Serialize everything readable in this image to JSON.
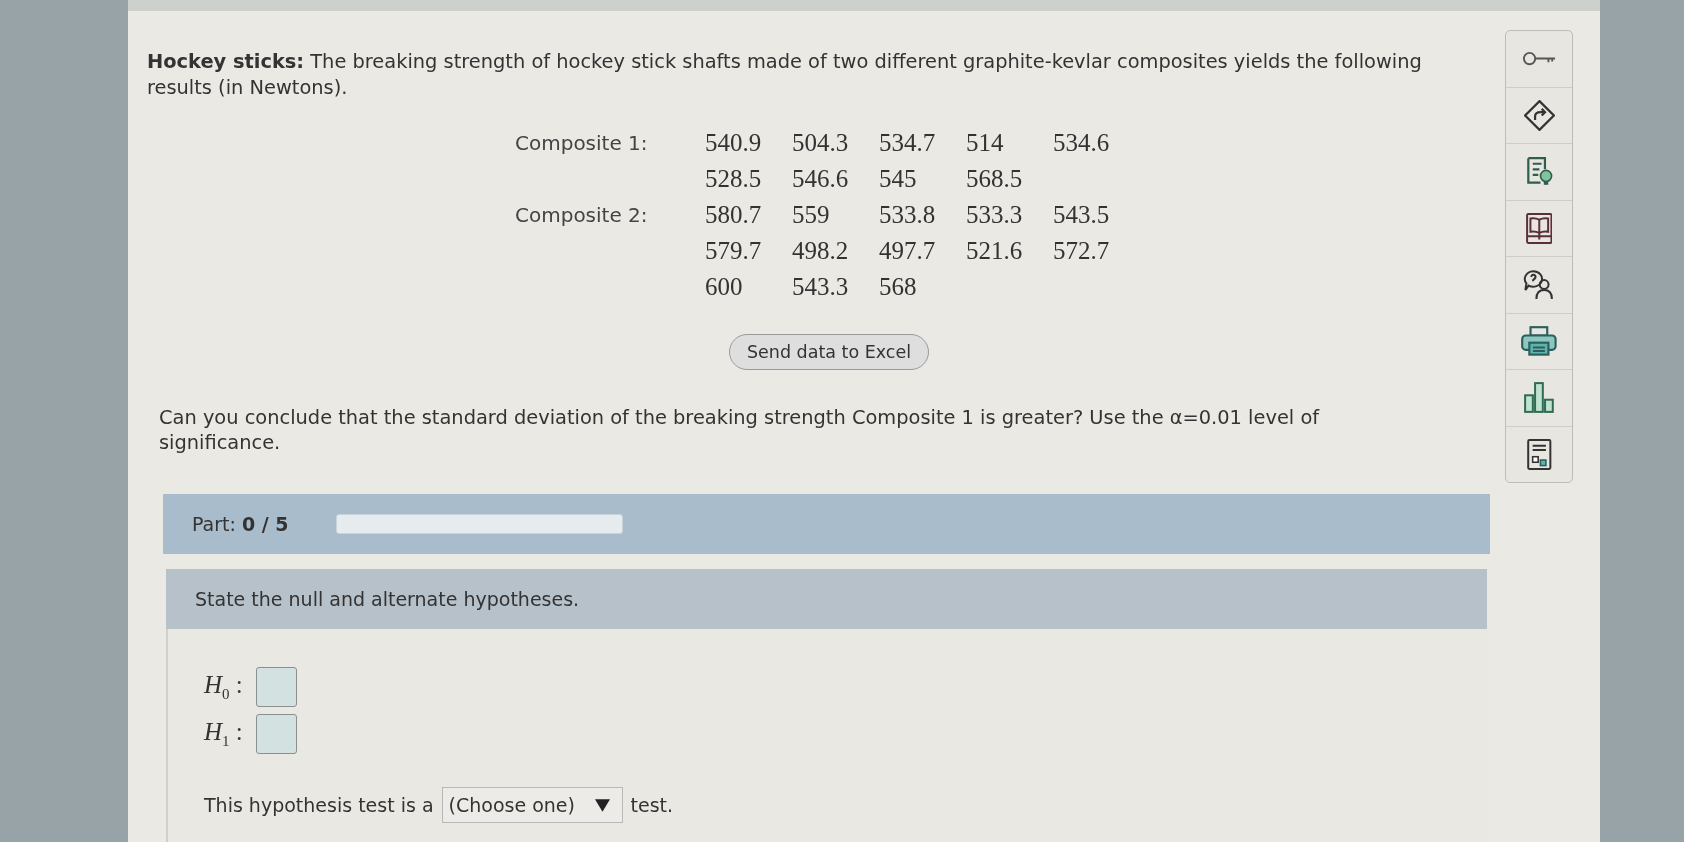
{
  "problem": {
    "intro": "**Hockey sticks:** The breaking strength of hockey stick shafts made of two different graphite-kevlar composites yields the following results (in Newtons)."
  },
  "data_table": {
    "groups": [
      {
        "label": "Composite 1:",
        "lines": [
          [
            "540.9",
            "504.3",
            "534.7",
            "514",
            "534.6"
          ],
          [
            "528.5",
            "546.6",
            "545",
            "568.5"
          ]
        ]
      },
      {
        "label": "Composite 2:",
        "lines": [
          [
            "580.7",
            "559",
            "533.8",
            "533.3",
            "543.5"
          ],
          [
            "579.7",
            "498.2",
            "497.7",
            "521.6",
            "572.7"
          ],
          [
            "600",
            "543.3",
            "568"
          ]
        ]
      }
    ]
  },
  "send_button": {
    "label": "Send data to Excel"
  },
  "question": "Can you conclude that the standard deviation of the breaking strength Composite 1 is greater? Use the α=0.01 level of significance.",
  "part": {
    "counter": "Part: **0 / 5**",
    "level": 0
  },
  "step": {
    "heading": "State the null and alternate hypotheses.",
    "hypotheses": [
      {
        "label": "*H*$_{0}$ :"
      },
      {
        "label": "*H*$_{1}$ :"
      }
    ],
    "test_sentence": {
      "before": "This hypothesis test is a",
      "dropdown": {
        "value": "(Choose one)"
      },
      "after": "test."
    }
  }
}
